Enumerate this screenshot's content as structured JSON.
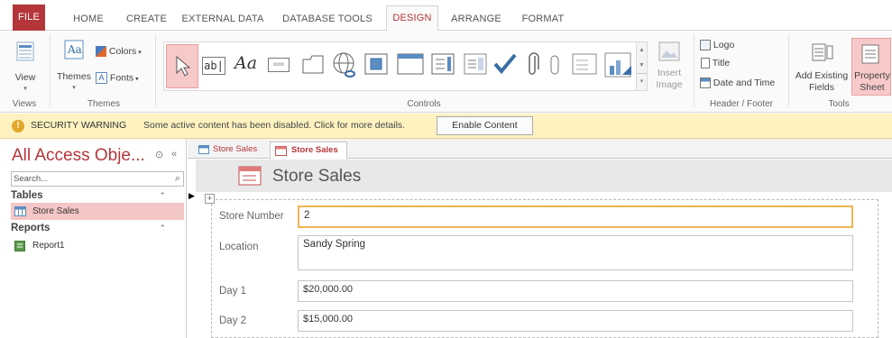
{
  "tabs": [
    "FILE",
    "HOME",
    "CREATE",
    "EXTERNAL DATA",
    "DATABASE TOOLS",
    "DESIGN",
    "ARRANGE",
    "FORMAT"
  ],
  "active_tab": "DESIGN",
  "ribbon": {
    "views": {
      "view_label": "View",
      "group_label": "Views"
    },
    "themes": {
      "themes_label": "Themes",
      "colors_label": "Colors",
      "fonts_label": "Fonts",
      "group_label": "Themes"
    },
    "controls": {
      "group_label": "Controls",
      "insert_image_line1": "Insert",
      "insert_image_line2": "Image"
    },
    "header_footer": {
      "logo_label": "Logo",
      "title_label": "Title",
      "date_time_label": "Date and Time",
      "group_label": "Header / Footer"
    },
    "tools": {
      "add_fields_line1": "Add Existing",
      "add_fields_line2": "Fields",
      "property_sheet_line1": "Property",
      "property_sheet_line2": "Sheet",
      "group_label": "Tools"
    }
  },
  "security_bar": {
    "title": "SECURITY WARNING",
    "message": "Some active content has been disabled. Click for more details.",
    "button_label": "Enable Content"
  },
  "nav_pane": {
    "title": "All Access Obje...",
    "search_placeholder": "Search...",
    "groups": [
      {
        "label": "Tables",
        "items": [
          "Store Sales"
        ]
      },
      {
        "label": "Reports",
        "items": [
          "Report1"
        ]
      }
    ]
  },
  "doc_tabs": [
    "Store Sales",
    "Store Sales"
  ],
  "form": {
    "title": "Store Sales",
    "fields": [
      {
        "label": "Store Number",
        "value": "2"
      },
      {
        "label": "Location",
        "value": "Sandy Spring"
      },
      {
        "label": "Day 1",
        "value": "$20,000.00"
      },
      {
        "label": "Day 2",
        "value": "$15,000.00"
      }
    ]
  },
  "colors": {
    "accent": "#b5363a",
    "warning_bg": "#fdf2c0",
    "selected_item": "#f5c6c6",
    "focus_border": "#f0b453"
  }
}
